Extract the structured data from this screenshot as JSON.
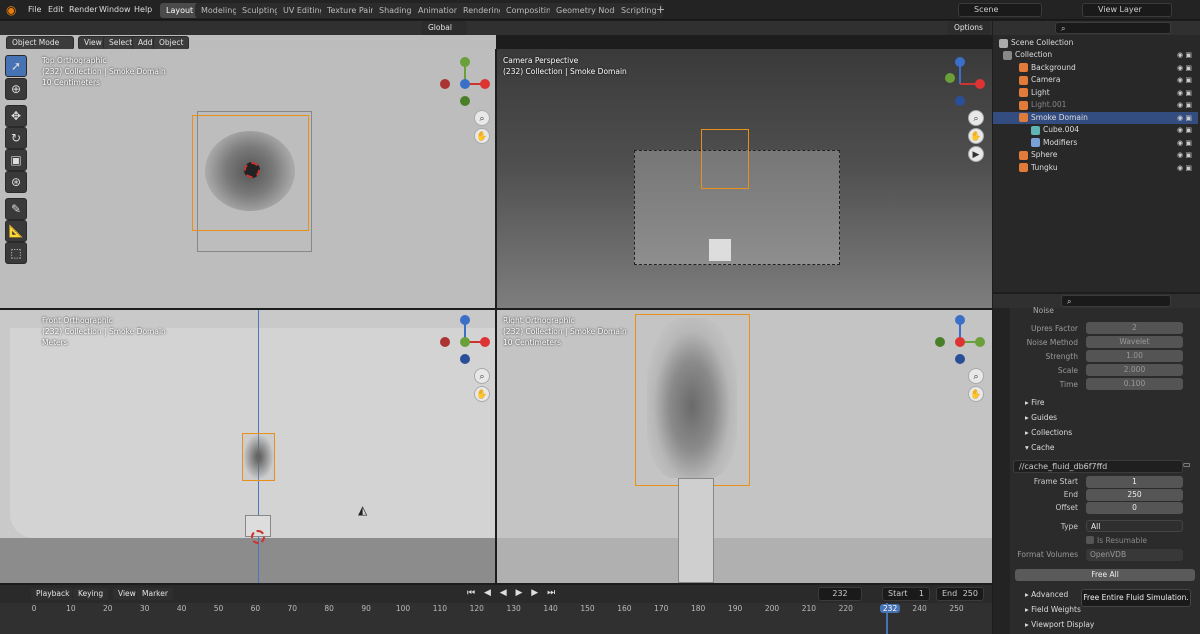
{
  "menus": [
    "File",
    "Edit",
    "Render",
    "Window",
    "Help"
  ],
  "workspaces": [
    "Layout",
    "Modeling",
    "Sculpting",
    "UV Editing",
    "Texture Paint",
    "Shading",
    "Animation",
    "Rendering",
    "Compositing",
    "Geometry Nodes",
    "Scripting"
  ],
  "active_workspace": "Layout",
  "scene": "Scene",
  "view_layer": "View Layer",
  "header": {
    "mode": "Object Mode",
    "view": "View",
    "select": "Select",
    "add": "Add",
    "object": "Object",
    "orientation": "Global",
    "options": "Options"
  },
  "viewports": {
    "top": {
      "title": "Top Orthographic",
      "sub": "(232) Collection | Smoke Domain",
      "scale": "10 Centimeters"
    },
    "camera": {
      "title": "Camera Perspective",
      "sub": "(232) Collection | Smoke Domain"
    },
    "front": {
      "title": "Front Orthographic",
      "sub": "(232) Collection | Smoke Domain",
      "scale": "Meters"
    },
    "right": {
      "title": "Right Orthographic",
      "sub": "(232) Collection | Smoke Domain",
      "scale": "10 Centimeters"
    }
  },
  "outliner": {
    "root": "Scene Collection",
    "items": [
      {
        "label": "Collection",
        "color": "#888"
      },
      {
        "label": "Background",
        "color": "#e07b39"
      },
      {
        "label": "Camera",
        "color": "#e07b39"
      },
      {
        "label": "Light",
        "color": "#e07b39"
      },
      {
        "label": "Light.001",
        "color": "#e07b39"
      },
      {
        "label": "Smoke Domain",
        "color": "#e07b39"
      },
      {
        "label": "Cube.004",
        "color": "#5fb3b3"
      },
      {
        "label": "Modifiers",
        "color": "#7aa0d8"
      },
      {
        "label": "Sphere",
        "color": "#e07b39"
      },
      {
        "label": "Tungku",
        "color": "#e07b39"
      }
    ]
  },
  "properties": {
    "noise_header": "Noise",
    "rows": [
      {
        "label": "Upres Factor",
        "value": "2"
      },
      {
        "label": "Noise Method",
        "value": "Wavelet"
      },
      {
        "label": "Strength",
        "value": "1.00"
      },
      {
        "label": "Scale",
        "value": "2.000"
      },
      {
        "label": "Time",
        "value": "0.100"
      }
    ],
    "panels": [
      "Fire",
      "Guides",
      "Collections",
      "Cache"
    ],
    "cache_path": "//cache_fluid_db6f7ffd",
    "frame_start_label": "Frame Start",
    "frame_start": "1",
    "end_label": "End",
    "end": "250",
    "offset_label": "Offset",
    "offset": "0",
    "type_label": "Type",
    "type": "All",
    "is_resumable": "Is Resumable",
    "format_label": "Format Volumes",
    "format": "OpenVDB",
    "free_all": "Free All",
    "bottom_panels": [
      "Advanced",
      "Field Weights",
      "Viewport Display"
    ],
    "tooltip": "Free Entire Fluid Simulation."
  },
  "timeline": {
    "playback": "Playback",
    "keying": "Keying",
    "view": "View",
    "marker": "Marker",
    "current": "232",
    "start_label": "Start",
    "start": "1",
    "end_label": "End",
    "end": "250",
    "ticks": [
      "0",
      "10",
      "20",
      "30",
      "40",
      "50",
      "60",
      "70",
      "80",
      "90",
      "100",
      "110",
      "120",
      "130",
      "140",
      "150",
      "160",
      "170",
      "180",
      "190",
      "200",
      "210",
      "220",
      "232",
      "240",
      "250"
    ]
  }
}
